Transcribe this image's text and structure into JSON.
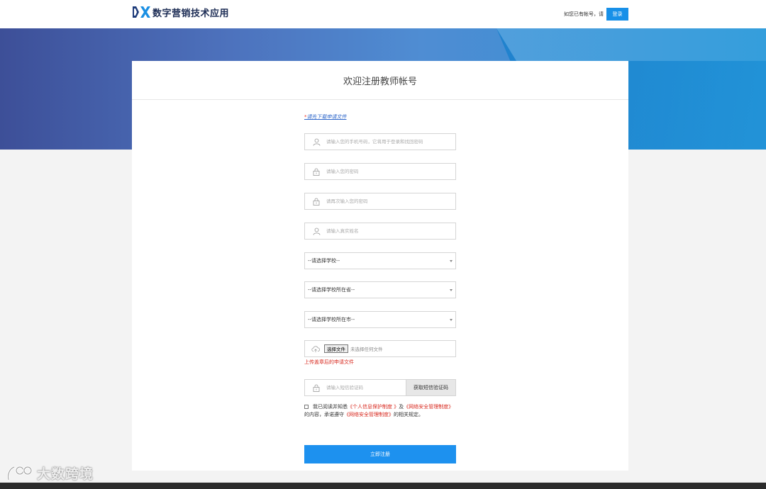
{
  "header": {
    "app_name": "数字营销技术应用",
    "login_hint": "如您已有帐号，请",
    "login_label": "登录"
  },
  "card": {
    "title": "欢迎注册教师帐号",
    "download_star": "*",
    "download_link": "请先下载申请文件"
  },
  "form": {
    "phone_placeholder": "请输入您的手机号码，它将用于登录和找回密码",
    "password_placeholder": "请输入您的密码",
    "password_confirm_placeholder": "请再次输入您的密码",
    "realname_placeholder": "请输入真实姓名",
    "school_select": "--请选择学校--",
    "province_select": "--请选择学校所在省--",
    "city_select": "--请选择学校所在市--",
    "file_button": "选择文件",
    "file_status": "未选择任何文件",
    "upload_note": "上传盖章后的申请文件",
    "sms_placeholder": "请输入短信验证码",
    "sms_button": "获取短信验证码",
    "agree_prefix": "我已阅读并知悉",
    "privacy_link": "《个人信息保护制度 》",
    "and_text": "及",
    "security_link1": "《网络安全管理制度》",
    "agree_middle": "的内容，承诺遵守",
    "security_link2": "《网络安全管理制度》",
    "agree_suffix": "的相关规定。",
    "submit_label": "立即注册"
  },
  "watermark": {
    "text": "大数跨境"
  },
  "colors": {
    "accent": "#1d91ef",
    "warning": "#d8281e",
    "link": "#2a64c9"
  }
}
